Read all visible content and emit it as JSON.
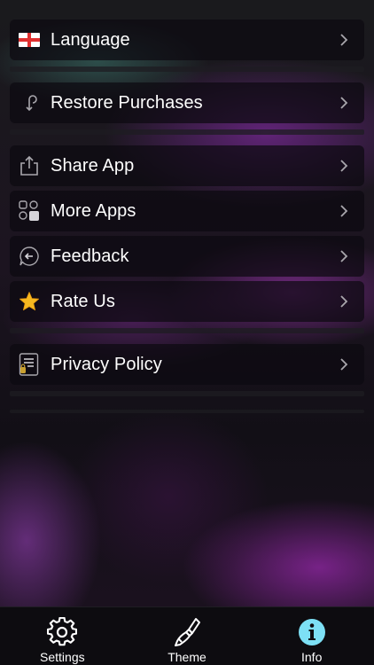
{
  "menu": {
    "items": [
      {
        "label": "Language",
        "icon": "flag-england-icon"
      },
      {
        "label": "Restore Purchases",
        "icon": "restore-icon"
      },
      {
        "label": "Share App",
        "icon": "share-icon"
      },
      {
        "label": "More Apps",
        "icon": "apps-icon"
      },
      {
        "label": "Feedback",
        "icon": "feedback-icon"
      },
      {
        "label": "Rate Us",
        "icon": "star-icon"
      },
      {
        "label": "Privacy Policy",
        "icon": "privacy-icon"
      }
    ]
  },
  "tabbar": {
    "tabs": [
      {
        "label": "Settings",
        "icon": "gear-icon"
      },
      {
        "label": "Theme",
        "icon": "brush-icon"
      },
      {
        "label": "Info",
        "icon": "info-icon",
        "active": true
      }
    ]
  },
  "colors": {
    "accent_info": "#7de0f5",
    "star": "#f5b820",
    "flag_red": "#e03030"
  }
}
